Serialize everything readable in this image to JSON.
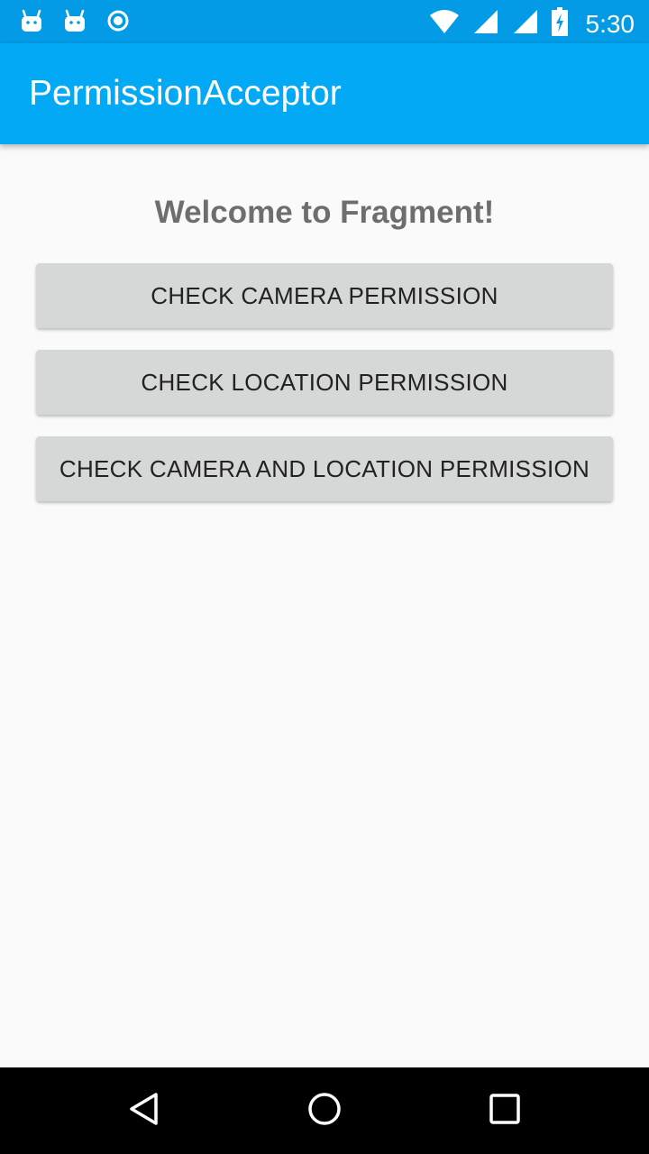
{
  "status_bar": {
    "time": "5:30",
    "left_icons": [
      "android-notification-icon",
      "android-notification-icon",
      "sync-circle-icon"
    ],
    "right_icons": [
      "wifi-icon",
      "signal-icon",
      "signal-icon",
      "battery-charging-icon"
    ],
    "background": "#039be5"
  },
  "app_bar": {
    "title": "PermissionAcceptor",
    "background": "#03a9f4"
  },
  "content": {
    "welcome": "Welcome to Fragment!",
    "buttons": [
      "CHECK CAMERA PERMISSION",
      "CHECK LOCATION PERMISSION",
      "CHECK CAMERA AND LOCATION PERMISSION"
    ]
  },
  "nav_bar": {
    "icons": [
      "back-icon",
      "home-icon",
      "recents-icon"
    ]
  }
}
